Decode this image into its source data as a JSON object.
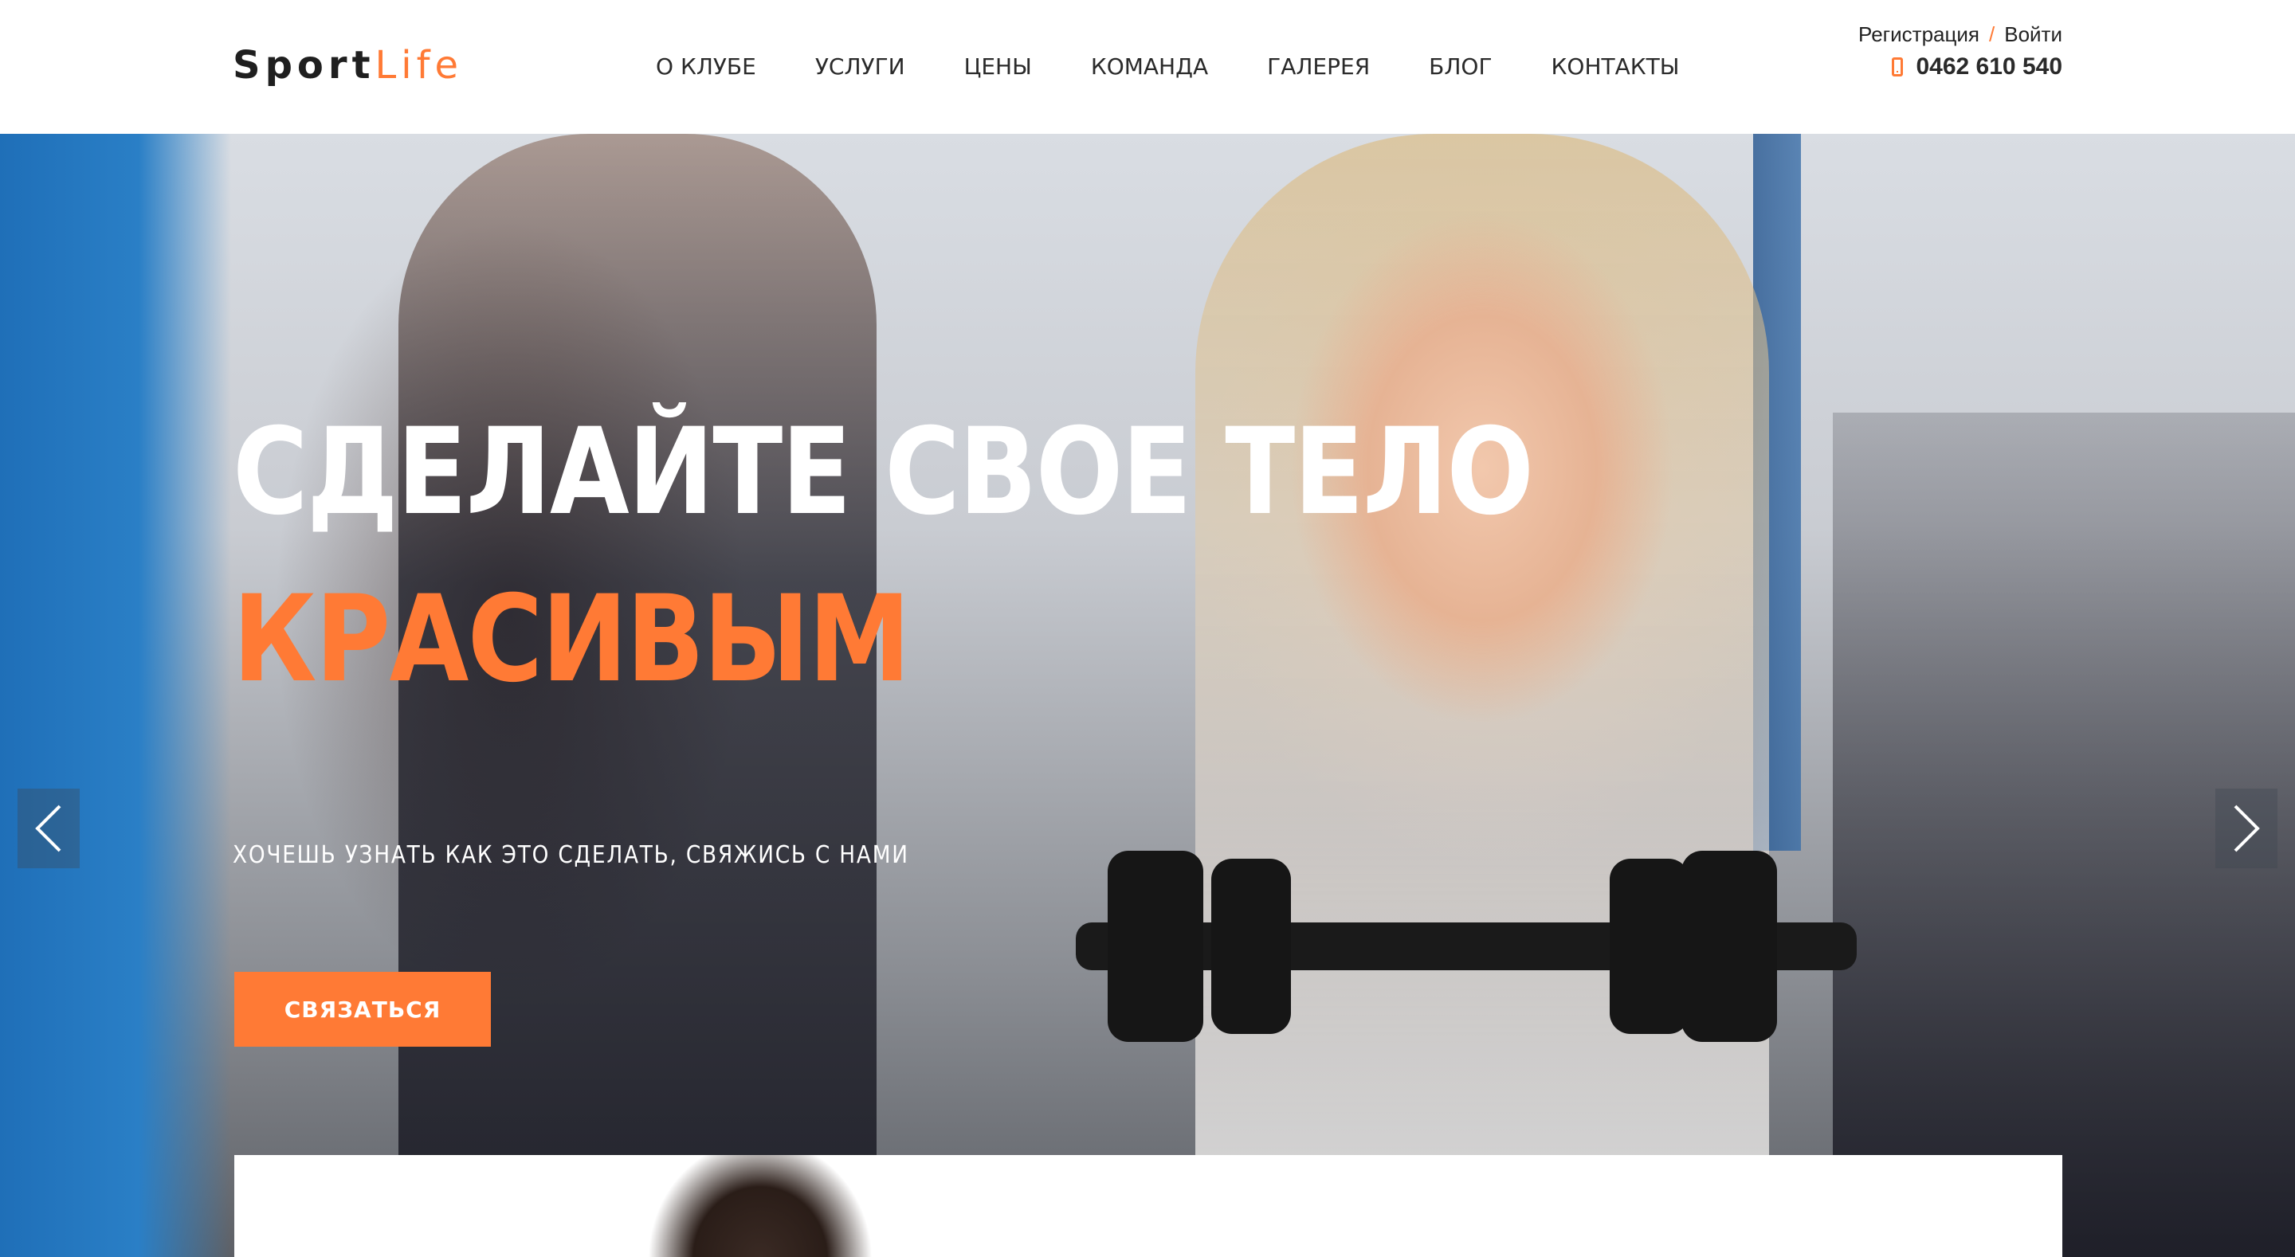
{
  "header": {
    "logo": {
      "part1": "Sport",
      "part2": "Life"
    },
    "nav": [
      {
        "label": "О КЛУБЕ"
      },
      {
        "label": "УСЛУГИ"
      },
      {
        "label": "ЦЕНЫ"
      },
      {
        "label": "КОМАНДА"
      },
      {
        "label": "ГАЛЕРЕЯ"
      },
      {
        "label": "БЛОГ"
      },
      {
        "label": "КОНТАКТЫ"
      }
    ],
    "auth": {
      "register": "Регистрация",
      "separator": "/",
      "login": "Войти"
    },
    "phone": {
      "icon": "mobile-phone-icon",
      "number": "0462 610 540"
    }
  },
  "hero": {
    "title_line1": "СДЕЛАЙТЕ СВОЕ ТЕЛО",
    "title_line2": "КРАСИВЫМ",
    "subtitle": "ХОЧЕШЬ УЗНАТЬ КАК ЭТО СДЕЛАТЬ, СВЯЖИСЬ С НАМИ",
    "cta_label": "СВЯЗАТЬСЯ",
    "prev_icon": "chevron-left-icon",
    "next_icon": "chevron-right-icon"
  },
  "colors": {
    "accent": "#ff7a35",
    "text_dark": "#2a2a2a",
    "white": "#ffffff"
  }
}
